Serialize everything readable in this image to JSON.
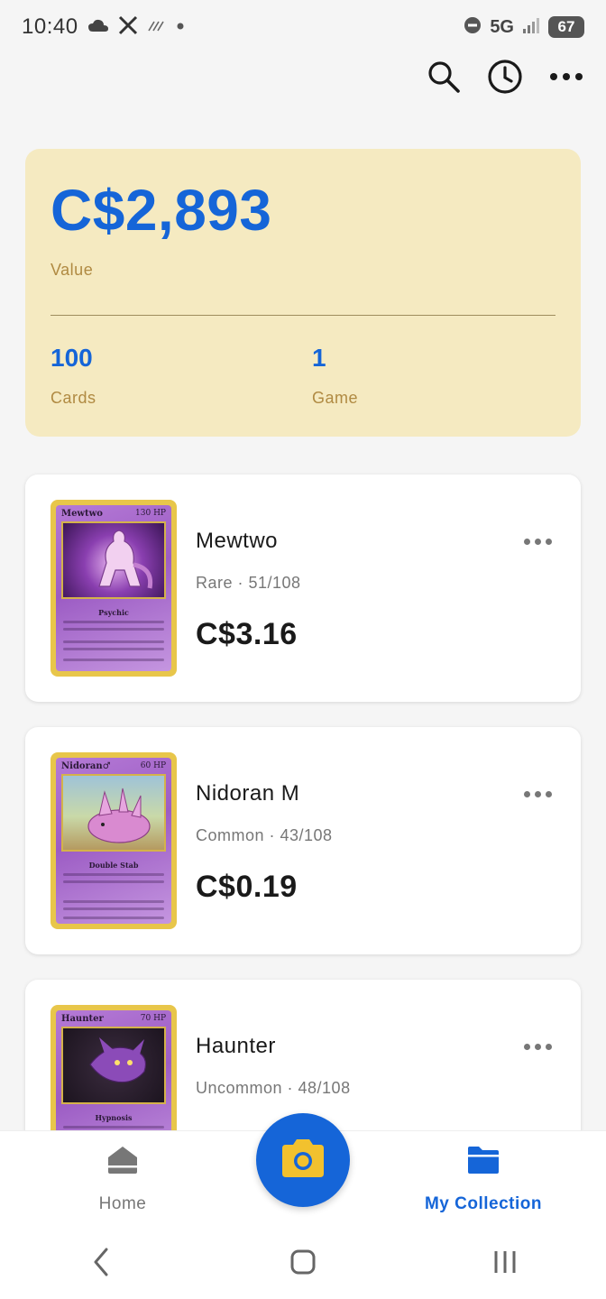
{
  "status_bar": {
    "time": "10:40",
    "network": "5G",
    "battery": "67",
    "left_icons": [
      "cloud-icon",
      "x-logo-icon",
      "signal-lines-icon",
      "dot-icon"
    ],
    "right_icons": [
      "dnd-icon",
      "signal-icon",
      "battery-icon"
    ]
  },
  "top_actions": [
    "search-icon",
    "history-icon",
    "more-icon"
  ],
  "summary": {
    "value": "C$2,893",
    "value_label": "Value",
    "cards_count": "100",
    "cards_label": "Cards",
    "games_count": "1",
    "games_label": "Game"
  },
  "cards": [
    {
      "name": "Mewtwo",
      "meta": "Rare · 51/108",
      "price": "C$3.16",
      "thumb_name": "Mewtwo",
      "thumb_hp": "130 HP",
      "thumb_attack": "Psychic",
      "thumb_color": "#a86fcf"
    },
    {
      "name": "Nidoran M",
      "meta": "Common · 43/108",
      "price": "C$0.19",
      "thumb_name": "Nidoran♂",
      "thumb_hp": "60 HP",
      "thumb_attack": "Double Stab",
      "thumb_color": "#b983d6"
    },
    {
      "name": "Haunter",
      "meta": "Uncommon · 48/108",
      "price": "",
      "thumb_name": "Haunter",
      "thumb_hp": "70 HP",
      "thumb_attack": "Hypnosis",
      "thumb_color": "#a46cc9"
    }
  ],
  "bottom_nav": {
    "home_label": "Home",
    "collection_label": "My Collection",
    "fab_icon": "camera-icon"
  },
  "colors": {
    "accent": "#1565d8",
    "summary_bg": "#f5eac1",
    "summary_label": "#b08a42",
    "fab_icon": "#f2c12e"
  }
}
